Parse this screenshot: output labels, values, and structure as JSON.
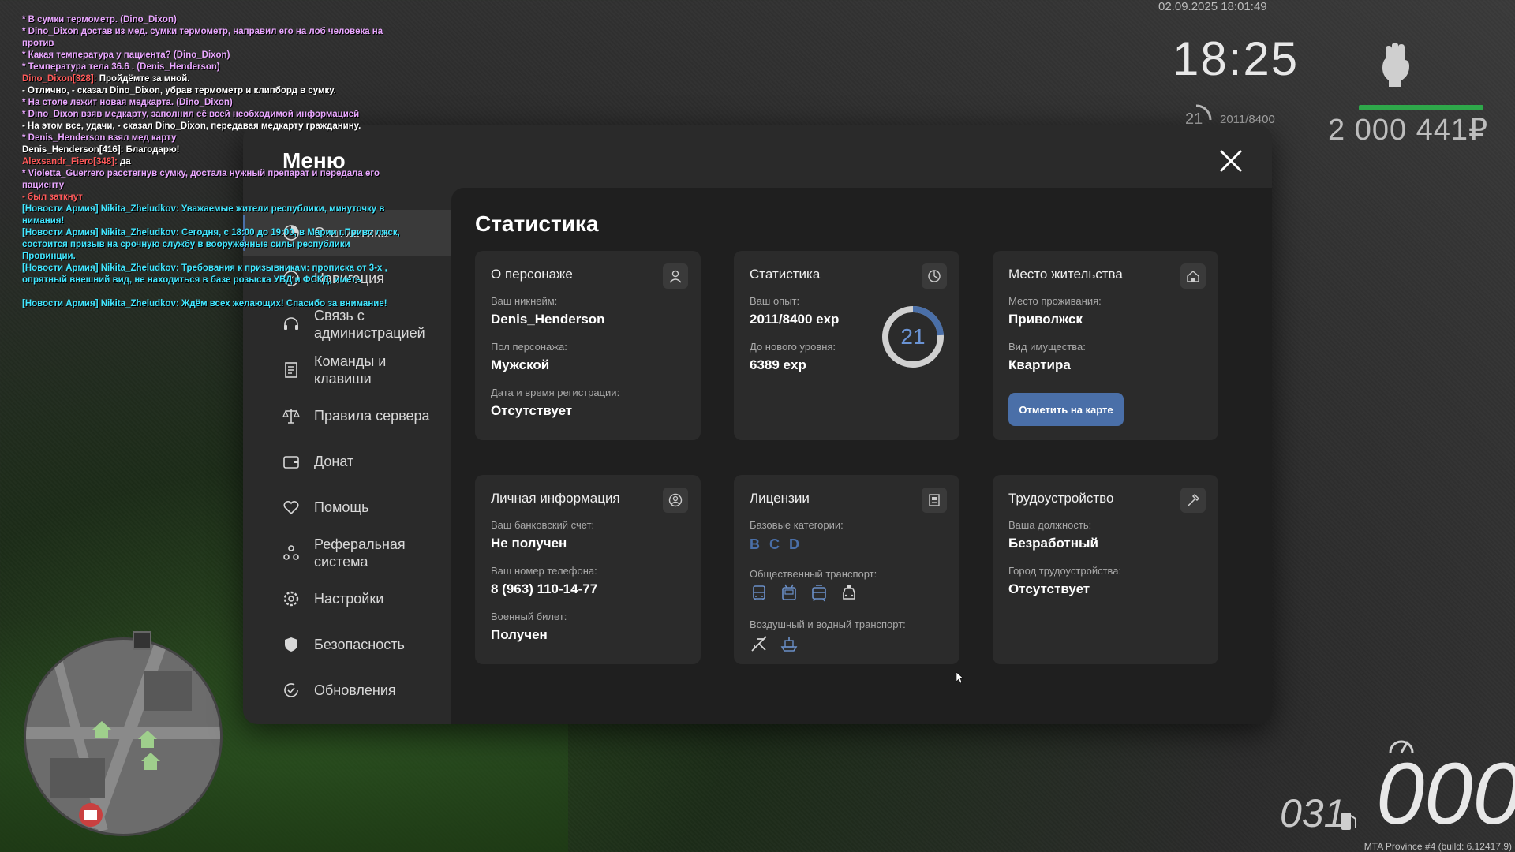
{
  "hud": {
    "datetime": "02.09.2025 18:01:49",
    "clock": "18:25",
    "level": "21",
    "exp": "2011/8400",
    "money": "2 000 441₽",
    "speed": "000",
    "fuel": "031",
    "build": "MTA Province #4 (build: 6.12417.9)",
    "health_fraction": 1.0
  },
  "chat": [
    {
      "text": "* В сумки термометр. (Dino_Dixon)",
      "color": "#e9a6ff"
    },
    {
      "text": "* Dino_Dixon достав из мед. сумки термометр, направил его на лоб человека на против",
      "color": "#e9a6ff"
    },
    {
      "text": "* Какая температура у пациента? (Dino_Dixon)",
      "color": "#e9a6ff"
    },
    {
      "text": "* Температура тела 36.6 . (Denis_Henderson)",
      "color": "#e9a6ff"
    },
    {
      "parts": [
        {
          "t": "Dino_Dixon[328]: ",
          "c": "#ff5a5a"
        },
        {
          "t": "Пройдёмте за мной.",
          "c": "#ffffff"
        }
      ]
    },
    {
      "text": "- Отлично, - сказал Dino_Dixon, убрав термометр и клипборд в сумку.",
      "color": "#ffffff"
    },
    {
      "text": "* На столе лежит новая медкарта. (Dino_Dixon)",
      "color": "#e9a6ff"
    },
    {
      "text": "* Dino_Dixon взяв медкарту, заполнил её всей необходимой информацией",
      "color": "#e9a6ff"
    },
    {
      "text": "- На этом все, удачи, - сказал Dino_Dixon, передавая медкарту гражданину.",
      "color": "#ffffff"
    },
    {
      "text": "* Denis_Henderson взял мед карту",
      "color": "#e9a6ff"
    },
    {
      "text": "Denis_Henderson[416]: Благодарю!",
      "color": "#ffffff"
    },
    {
      "parts": [
        {
          "t": "Alexsandr_Fiero[348]: ",
          "c": "#ff5a5a"
        },
        {
          "t": "да",
          "c": "#ffffff"
        }
      ]
    },
    {
      "text": "* Violetta_Guerrero расстегнув сумку, достала нужный препарат и передала его пациенту",
      "color": "#e9a6ff"
    },
    {
      "text": "- был заткнут",
      "color": "#ff5a5a"
    },
    {
      "text": "[Новости Армия] Nikita_Zheludkov: Уважаемые жители республики, минуточку в нимания!",
      "color": "#41e6ff"
    },
    {
      "text": "[Новости Армия] Nikita_Zheludkov: Сегодня, с 18:00 до 19:00, в Марии г.Приво лжск, состоится призыв на срочную службу в вооружённые силы республики Провинции.",
      "color": "#41e6ff"
    },
    {
      "text": "[Новости Армия] Nikita_Zheludkov: Требования к призывникам: прописка от 3-х , опрятный внешний вид, не находиться в базе розыска УВД и ФСКД, иметь",
      "color": "#41e6ff"
    },
    {
      "text": " ",
      "color": "#41e6ff"
    },
    {
      "text": "[Новости Армия] Nikita_Zheludkov: Ждём всех желающих! Спасибо за внимание!",
      "color": "#41e6ff"
    }
  ],
  "menu": {
    "title": "Меню",
    "sidebar": [
      {
        "label": "Статистика",
        "icon": "chart-icon",
        "active": true
      },
      {
        "label": "Навигация",
        "icon": "compass-icon"
      },
      {
        "label": "Связь с администрацией",
        "icon": "headset-icon"
      },
      {
        "label": "Команды и клавиши",
        "icon": "document-icon"
      },
      {
        "label": "Правила сервера",
        "icon": "scales-icon"
      },
      {
        "label": "Донат",
        "icon": "wallet-icon"
      },
      {
        "label": "Помощь",
        "icon": "heart-hands-icon"
      },
      {
        "label": "Реферальная система",
        "icon": "referral-icon"
      },
      {
        "label": "Настройки",
        "icon": "gear-icon"
      },
      {
        "label": "Безопасность",
        "icon": "shield-icon"
      },
      {
        "label": "Обновления",
        "icon": "refresh-check-icon"
      }
    ]
  },
  "content": {
    "title": "Статистика",
    "character": {
      "title": "О персонаже",
      "nick_label": "Ваш никнейм:",
      "nick": "Denis_Henderson",
      "gender_label": "Пол персонажа:",
      "gender": "Мужской",
      "reg_label": "Дата и время регистрации:",
      "reg": "Отсутствует"
    },
    "stats": {
      "title": "Статистика",
      "exp_label": "Ваш опыт:",
      "exp": "2011/8400 exp",
      "next_label": "До нового уровня:",
      "next": "6389 exp",
      "level": "21",
      "progress_fraction": 0.24
    },
    "residence": {
      "title": "Место жительства",
      "place_label": "Место проживания:",
      "place": "Приволжск",
      "property_label": "Вид имущества:",
      "property": "Квартира",
      "button": "Отметить на карте"
    },
    "personal": {
      "title": "Личная информация",
      "bank_label": "Ваш банковский счет:",
      "bank": "Не получен",
      "phone_label": "Ваш номер телефона:",
      "phone": "8 (963) 110-14-77",
      "military_label": "Военный билет:",
      "military": "Получен"
    },
    "licenses": {
      "title": "Лицензии",
      "base_label": "Базовые категории:",
      "base": [
        "B",
        "C",
        "D"
      ],
      "public_label": "Общественный транспорт:",
      "public_icons": [
        "bus-icon",
        "trolleybus-icon",
        "tram-icon",
        "taxi-icon"
      ],
      "airwater_label": "Воздушный и водный транспорт:",
      "airwater_icons": [
        "plane-icon",
        "boat-icon"
      ]
    },
    "job": {
      "title": "Трудоустройство",
      "position_label": "Ваша должность:",
      "position": "Безработный",
      "city_label": "Город трудоустройства:",
      "city": "Отсутствует"
    }
  },
  "colors": {
    "accent": "#4a6fa8",
    "chat_action": "#e9a6ff",
    "chat_news": "#41e6ff",
    "chat_red": "#ff5a5a",
    "health": "#2ea84a"
  }
}
